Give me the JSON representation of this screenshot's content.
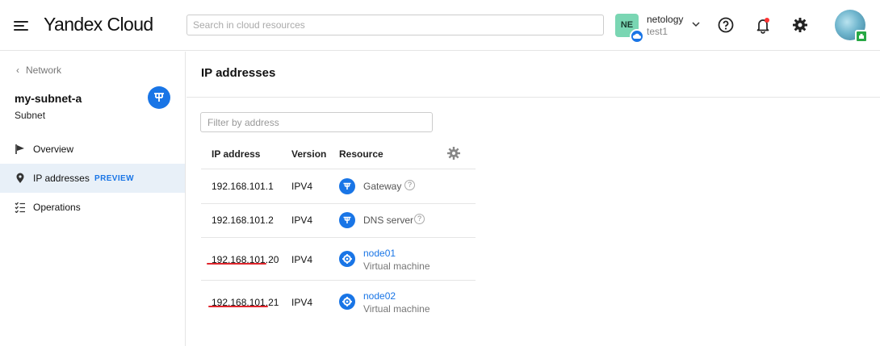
{
  "header": {
    "logo_yandex": "Yandex",
    "logo_cloud": "Cloud",
    "search_placeholder": "Search in cloud resources",
    "account": {
      "initials": "NE",
      "name": "netology",
      "folder": "test1"
    },
    "notification_dot_color": "#ff3333"
  },
  "sidebar": {
    "back_label": "Network",
    "resource_title": "my-subnet-a",
    "resource_type": "Subnet",
    "items": [
      {
        "label": "Overview",
        "icon": "flag-icon",
        "active": false
      },
      {
        "label": "IP addresses",
        "icon": "location-pin-icon",
        "active": true,
        "badge": "PREVIEW"
      },
      {
        "label": "Operations",
        "icon": "checklist-icon",
        "active": false
      }
    ]
  },
  "main": {
    "title": "IP addresses",
    "filter_placeholder": "Filter by address",
    "columns": [
      "IP address",
      "Version",
      "Resource"
    ],
    "rows": [
      {
        "ip": "192.168.101.1",
        "version": "IPV4",
        "resource": "Gateway",
        "help": "?"
      },
      {
        "ip": "192.168.101.2",
        "version": "IPV4",
        "resource": "DNS server",
        "help": "?"
      },
      {
        "ip": "192.168.101.20",
        "version": "IPV4",
        "resource": "node01",
        "resource_sub": "Virtual machine"
      },
      {
        "ip": "192.168.101.21",
        "version": "IPV4",
        "resource": "node02",
        "resource_sub": "Virtual machine"
      }
    ]
  },
  "colors": {
    "accent": "#1975e6",
    "active_nav_bg": "#e8f0f8",
    "annotation_underline": "#e0262d",
    "account_badge": "#7ad6b3"
  }
}
